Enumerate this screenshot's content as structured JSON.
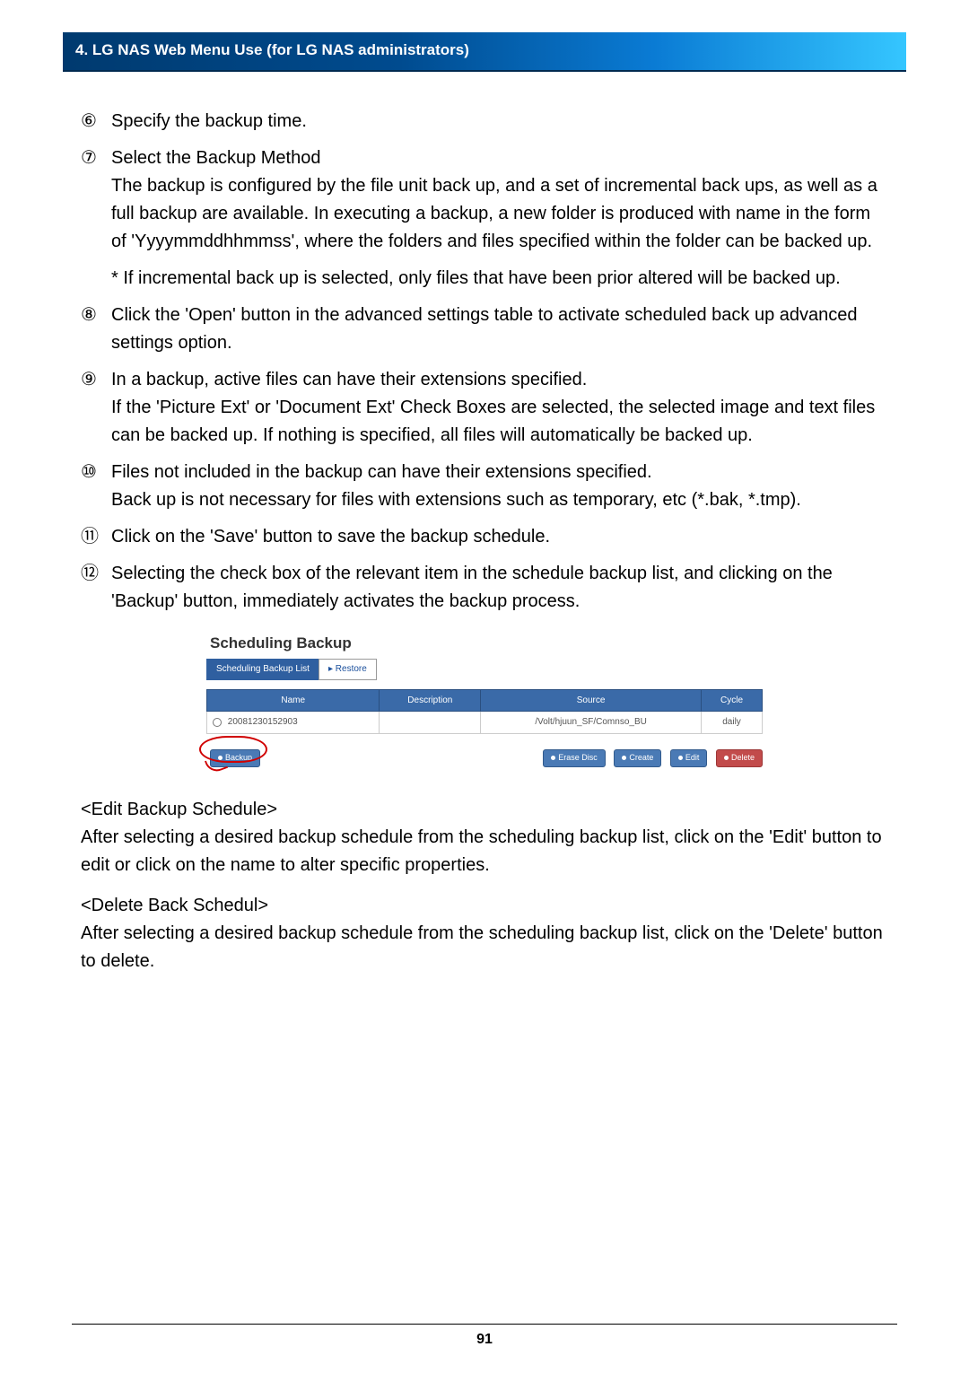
{
  "header": {
    "title": "4. LG NAS Web Menu Use (for LG NAS administrators)"
  },
  "steps": {
    "s6": {
      "num": "⑥",
      "text": "Specify the backup time."
    },
    "s7": {
      "num": "⑦",
      "title": "Select the Backup Method",
      "body": "The backup is configured by the file unit back up, and a set of incremental back ups, as well as a full backup are available. In executing a backup, a new folder is produced with name in the form of 'Yyyymmddhhmmss', where the folders and files specified within the folder can be backed up.",
      "note": "* If incremental back up is selected, only files that have been prior altered will be backed up."
    },
    "s8": {
      "num": "⑧",
      "text": "Click the 'Open' button in the advanced settings table to activate scheduled back up advanced settings option."
    },
    "s9": {
      "num": "⑨",
      "line1": "In a backup, active files can have their extensions specified.",
      "line2": "If the 'Picture Ext' or 'Document Ext' Check Boxes are selected, the selected image and text files can be backed up. If nothing is specified, all files will automatically be backed up."
    },
    "s10": {
      "num": "⑩",
      "line1": "Files not included in the backup can have their extensions specified.",
      "line2": "Back up is not necessary for files with extensions such as temporary, etc (*.bak, *.tmp)."
    },
    "s11": {
      "num": "⑪",
      "text": "Click on the 'Save' button to save the backup schedule."
    },
    "s12": {
      "num": "⑫",
      "text": "Selecting the check box of the relevant item in the schedule backup list, and clicking on the 'Backup' button, immediately activates the backup process."
    }
  },
  "screenshot": {
    "title": "Scheduling Backup",
    "tabs": {
      "active": "Scheduling Backup List",
      "inactive": "Restore"
    },
    "headers": {
      "name": "Name",
      "description": "Description",
      "source": "Source",
      "cycle": "Cycle"
    },
    "row": {
      "name": "20081230152903",
      "description": "",
      "source": "/Volt/hjuun_SF/Comnso_BU",
      "cycle": "daily"
    },
    "buttons": {
      "backup": "Backup",
      "erase": "Erase Disc",
      "create": "Create",
      "edit": "Edit",
      "delete": "Delete"
    }
  },
  "after": {
    "edit_heading": "<Edit Backup Schedule>",
    "edit_body": "After selecting a desired backup schedule from the scheduling backup list, click on the 'Edit' button to edit or click on the name to alter specific  properties.",
    "delete_heading": "<Delete Back Schedul>",
    "delete_body": "After selecting a desired backup schedule from the scheduling backup list, click on the 'Delete' button to delete."
  },
  "page_number": "91"
}
